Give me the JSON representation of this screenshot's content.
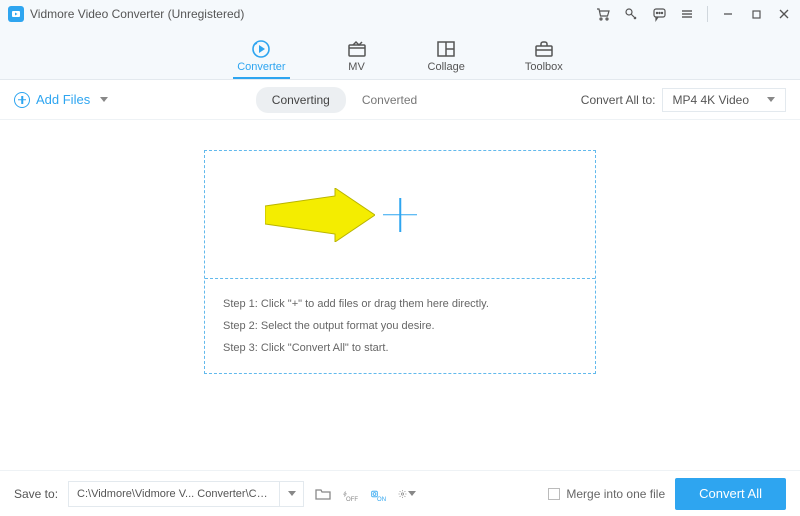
{
  "titlebar": {
    "title": "Vidmore Video Converter (Unregistered)"
  },
  "tabs": [
    {
      "label": "Converter",
      "active": true
    },
    {
      "label": "MV",
      "active": false
    },
    {
      "label": "Collage",
      "active": false
    },
    {
      "label": "Toolbox",
      "active": false
    }
  ],
  "toolbar": {
    "add_files": "Add Files",
    "seg_converting": "Converting",
    "seg_converted": "Converted",
    "convert_all_to_label": "Convert All to:",
    "format_selected": "MP4 4K Video"
  },
  "dropzone": {
    "step1": "Step 1: Click \"+\" to add files or drag them here directly.",
    "step2": "Step 2: Select the output format you desire.",
    "step3": "Step 3: Click \"Convert All\" to start."
  },
  "bottombar": {
    "save_to_label": "Save to:",
    "path": "C:\\Vidmore\\Vidmore V... Converter\\Converted",
    "merge_label": "Merge into one file",
    "convert_all": "Convert All"
  }
}
